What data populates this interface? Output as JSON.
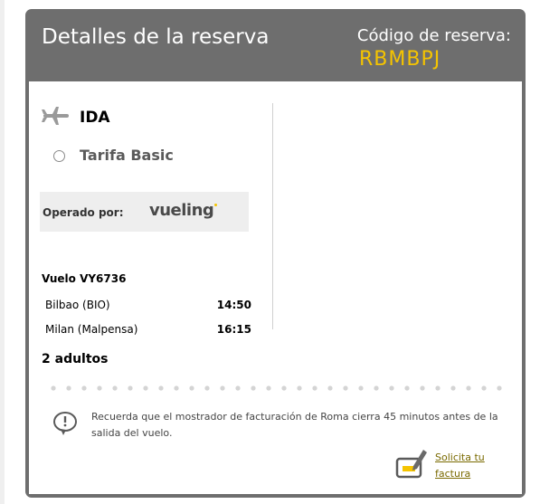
{
  "header": {
    "title": "Detalles de la reserva",
    "code_label": "Código de reserva:",
    "code_value": "RBMBPJ"
  },
  "flight": {
    "direction": "IDA",
    "fare": "Tarifa Basic",
    "operated_by_label": "Operado por:",
    "operator_logo": "vueling",
    "flight_number": "Vuelo VY6736",
    "departure": {
      "city": "Bilbao (BIO)",
      "time": "14:50"
    },
    "arrival": {
      "city": "Milan (Malpensa)",
      "time": "16:15"
    },
    "passengers": "2 adultos"
  },
  "notice": {
    "text": "Recuerda que el mostrador de facturación de Roma cierra 45 minutos antes de la salida del vuelo."
  },
  "invoice": {
    "link_text": "Solicita tu factura"
  },
  "icons": {
    "plane": "plane-icon",
    "notice": "speech-bubble-alert-icon",
    "invoice": "invoice-pen-icon"
  },
  "colors": {
    "header_bg": "#6e6e6e",
    "accent": "#f5c400",
    "link": "#7a6a00"
  }
}
